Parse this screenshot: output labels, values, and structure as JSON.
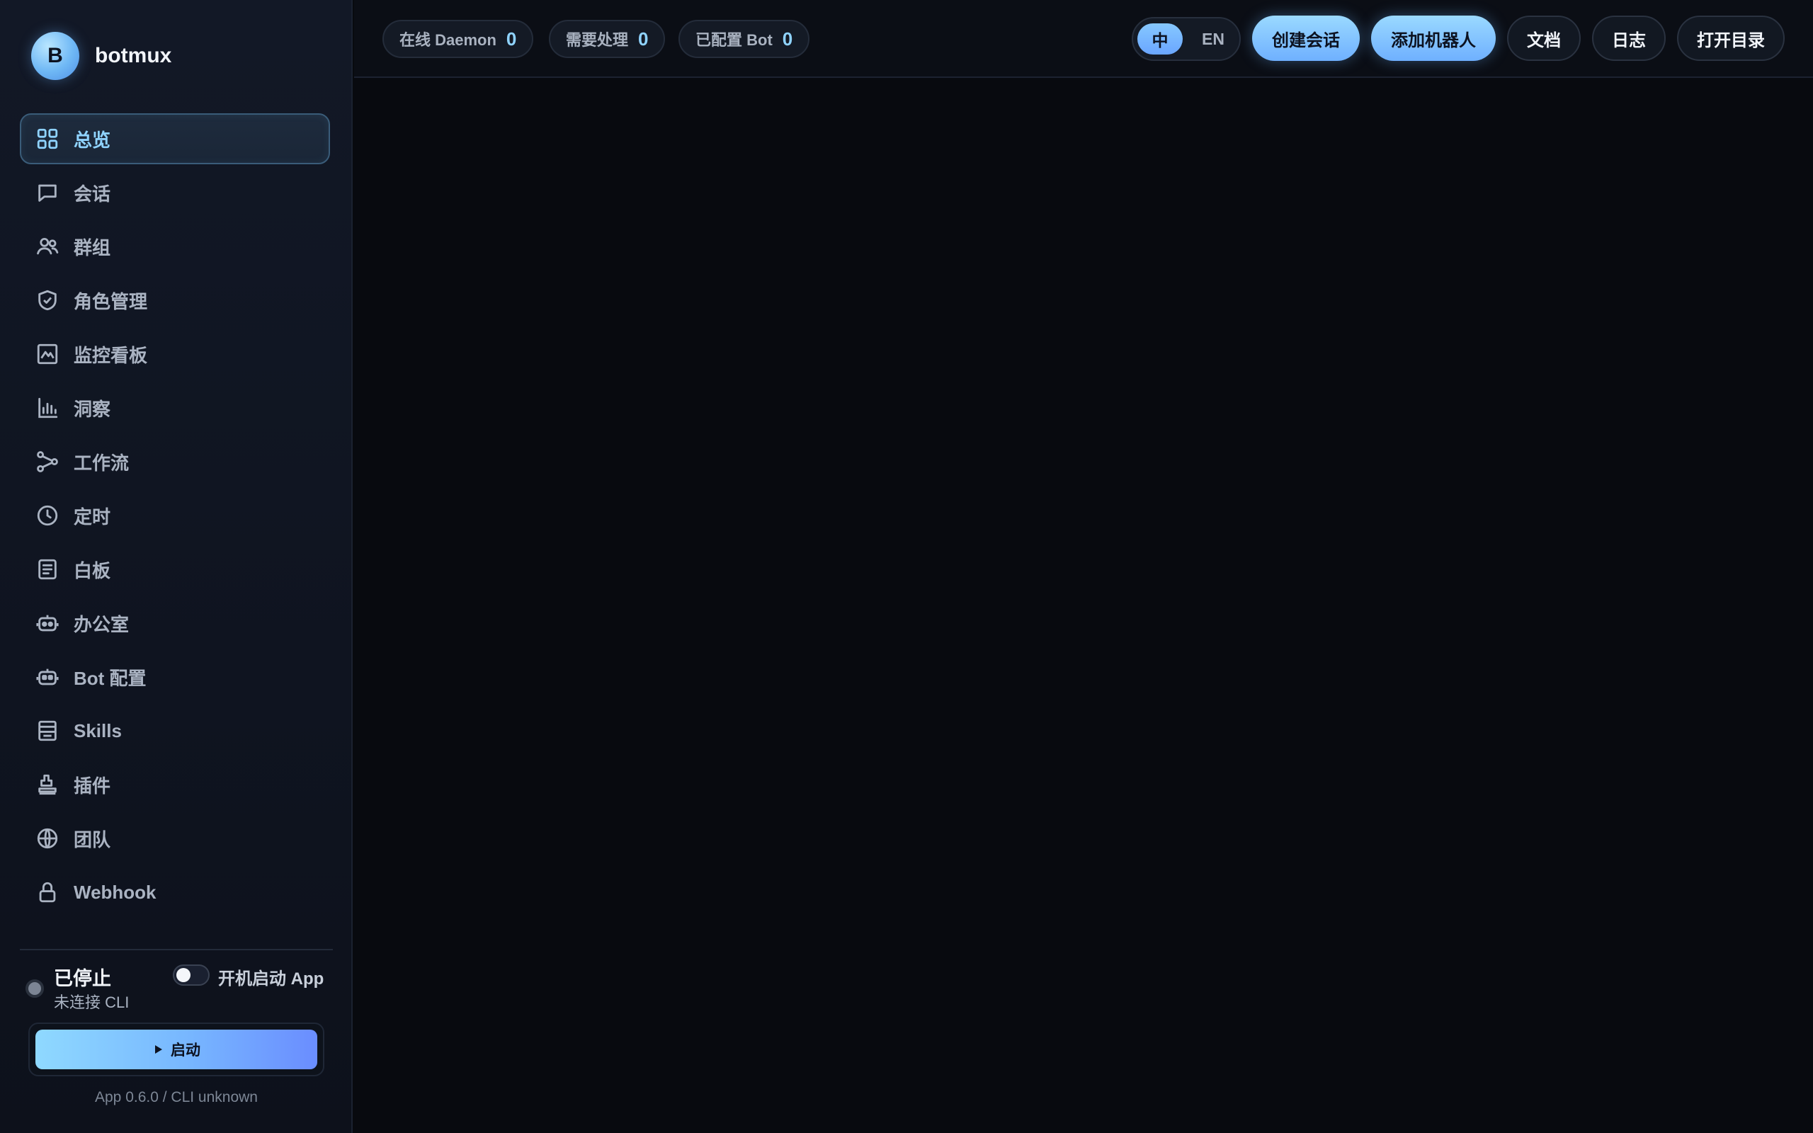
{
  "brand": {
    "avatar_letter": "B",
    "name": "botmux"
  },
  "nav": {
    "items": [
      {
        "label": "总览",
        "icon": "grid-icon",
        "active": true
      },
      {
        "label": "会话",
        "icon": "chat-icon"
      },
      {
        "label": "群组",
        "icon": "users-icon"
      },
      {
        "label": "角色管理",
        "icon": "shield-check-icon"
      },
      {
        "label": "监控看板",
        "icon": "activity-chart-icon"
      },
      {
        "label": "洞察",
        "icon": "bar-chart-icon"
      },
      {
        "label": "工作流",
        "icon": "workflow-icon"
      },
      {
        "label": "定时",
        "icon": "clock-icon"
      },
      {
        "label": "白板",
        "icon": "document-icon"
      },
      {
        "label": "办公室",
        "icon": "robot-icon"
      },
      {
        "label": "Bot 配置",
        "icon": "bot-icon"
      },
      {
        "label": "Skills",
        "icon": "archive-icon"
      },
      {
        "label": "插件",
        "icon": "plugin-icon"
      },
      {
        "label": "团队",
        "icon": "globe-icon"
      },
      {
        "label": "Webhook",
        "icon": "lock-icon"
      }
    ]
  },
  "status": {
    "title": "已停止",
    "subtitle": "未连接 CLI",
    "autostart_label": "开机启动 App",
    "autostart_on": false,
    "start_label": "启动",
    "version": "App 0.6.0 / CLI unknown"
  },
  "topbar": {
    "stats": [
      {
        "label": "在线 Daemon",
        "value": "0"
      },
      {
        "label": "需要处理",
        "value": "0"
      },
      {
        "label": "已配置 Bot",
        "value": "0"
      }
    ],
    "lang": {
      "zh": "中",
      "en": "EN",
      "selected": "zh"
    },
    "buttons": {
      "create_session": "创建会话",
      "add_bot": "添加机器人",
      "docs": "文档",
      "logs": "日志",
      "open_dir": "打开目录"
    }
  },
  "colors": {
    "accent": "#8fd3ff",
    "primary_gradient_start": "#9ad9ff",
    "primary_gradient_end": "#6fb0ff",
    "background": "#080a0f",
    "sidebar": "#121826"
  }
}
